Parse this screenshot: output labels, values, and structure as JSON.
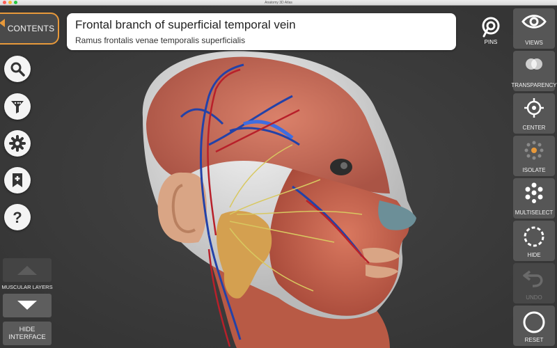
{
  "window": {
    "title": "Anatomy 3D Atlas"
  },
  "contents_button": {
    "label": "CONTENTS"
  },
  "selection": {
    "english_name": "Frontal branch of superficial temporal vein",
    "latin_name": "Ramus frontalis venae temporalis superficialis"
  },
  "left_tools": [
    {
      "name": "search-icon"
    },
    {
      "name": "filter-icon"
    },
    {
      "name": "gear-icon"
    },
    {
      "name": "bookmark-add-icon"
    },
    {
      "name": "help-icon"
    }
  ],
  "layers": {
    "label": "MUSCULAR LAYERS"
  },
  "hide_interface": {
    "label": "HIDE INTERFACE"
  },
  "pins": {
    "label": "PINS"
  },
  "right_tools": [
    {
      "label": "VIEWS",
      "icon": "eye-icon"
    },
    {
      "label": "TRANSPARENCY",
      "icon": "transparency-icon"
    },
    {
      "label": "CENTER",
      "icon": "crosshair-icon"
    },
    {
      "label": "ISOLATE",
      "icon": "isolate-icon"
    },
    {
      "label": "MULTISELECT",
      "icon": "multiselect-icon"
    },
    {
      "label": "HIDE",
      "icon": "hide-icon"
    },
    {
      "label": "UNDO",
      "icon": "undo-icon"
    },
    {
      "label": "RESET",
      "icon": "reset-icon"
    }
  ],
  "colors": {
    "accent": "#e8993a",
    "background": "#3b3b3b",
    "muscle": "#c9634f",
    "vein": "#2342a8",
    "artery": "#b8202a",
    "nerve": "#d8c860",
    "gland": "#d4a050",
    "skin": "#d9a585"
  }
}
